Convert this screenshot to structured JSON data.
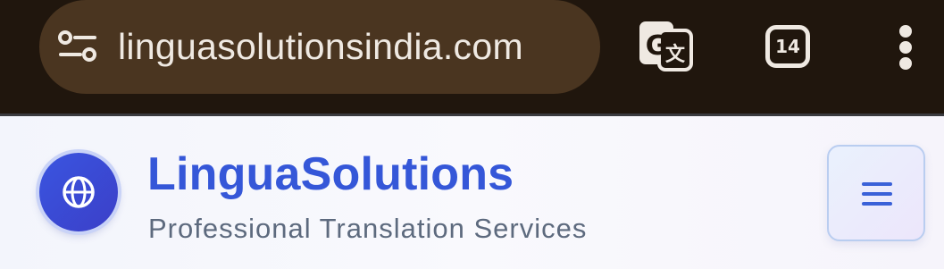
{
  "browser": {
    "url": "linguasolutionsindia.com",
    "tab_count": "14",
    "icons": {
      "site_settings": "tune-icon",
      "translate": "google-translate-icon",
      "tabs": "tab-switcher-icon",
      "menu": "more-vert-icon"
    },
    "colors": {
      "bar": "#20160d",
      "url_box": "#4a3520",
      "foreground": "#efe9e2"
    }
  },
  "site": {
    "brand_name": "LinguaSolutions",
    "tagline": "Professional Translation Services",
    "icons": {
      "logo": "globe-icon",
      "menu": "hamburger-menu-icon"
    },
    "colors": {
      "brand": "#3557d8",
      "tagline": "#5d6a7e",
      "logo_bg": "#3a55e0"
    }
  }
}
